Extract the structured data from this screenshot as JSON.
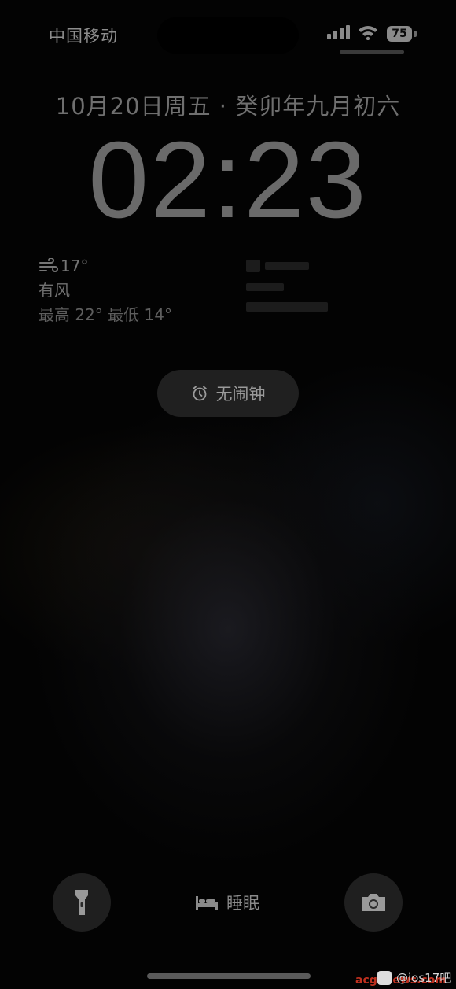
{
  "status_bar": {
    "carrier": "中国移动",
    "battery": "75",
    "icons": [
      "signal-icon",
      "wifi-icon",
      "battery-icon"
    ]
  },
  "lock_screen": {
    "date": "10月20日周五 · 癸卯年九月初六",
    "time": "02:23"
  },
  "weather": {
    "icon": "wind-icon",
    "temperature": "17°",
    "condition": "有风",
    "range": "最高 22° 最低 14°"
  },
  "alarm": {
    "icon": "alarm-clock-icon",
    "label": "无闹钟"
  },
  "bottom": {
    "left_icon": "flashlight-icon",
    "right_icon": "camera-icon",
    "sleep_icon": "bed-icon",
    "sleep_label": "睡眠"
  },
  "watermark": {
    "site": "acgnoews.com",
    "handle": "@ios17吧"
  },
  "colors": {
    "background": "#030303",
    "text_primary": "#6a6a6a",
    "pill_bg": "#262626",
    "watermark_red": "#c0301f"
  }
}
